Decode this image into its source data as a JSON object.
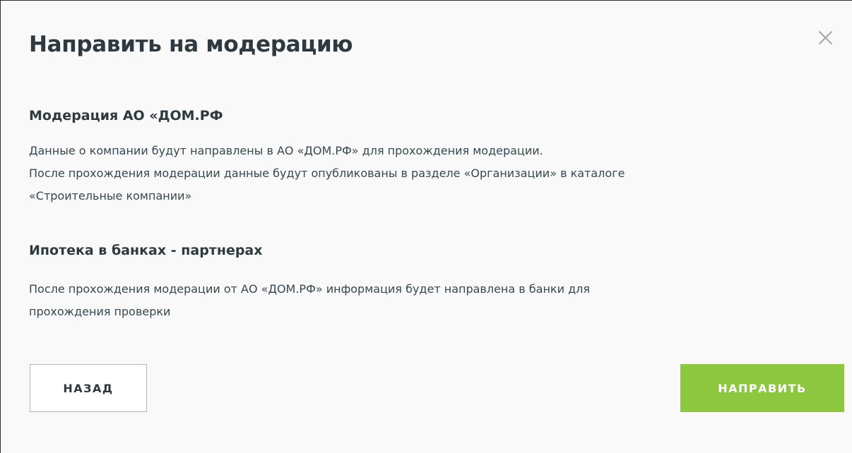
{
  "modal": {
    "title": "Направить на модерацию",
    "close_icon": "close-icon",
    "sections": [
      {
        "heading": "Модерация АО «ДОМ.РФ",
        "lines": [
          "Данные о компании будут направлены в АО «ДОМ.РФ» для прохождения модерации.",
          "После прохождения модерации данные будут опубликованы в разделе «Организации» в каталоге",
          "«Строительные компании»"
        ]
      },
      {
        "heading": "Ипотека в банках - партнерах",
        "lines": [
          "После прохождения модерации от АО «ДОМ.РФ» информация будет направлена в банки для",
          "прохождения проверки"
        ]
      }
    ],
    "buttons": {
      "back_label": "НАЗАД",
      "send_label": "НАПРАВИТЬ"
    }
  },
  "colors": {
    "background": "#f9f9f9",
    "text": "#2e3a40",
    "accent": "#8dc63f",
    "button_border": "#b5b5b5"
  }
}
